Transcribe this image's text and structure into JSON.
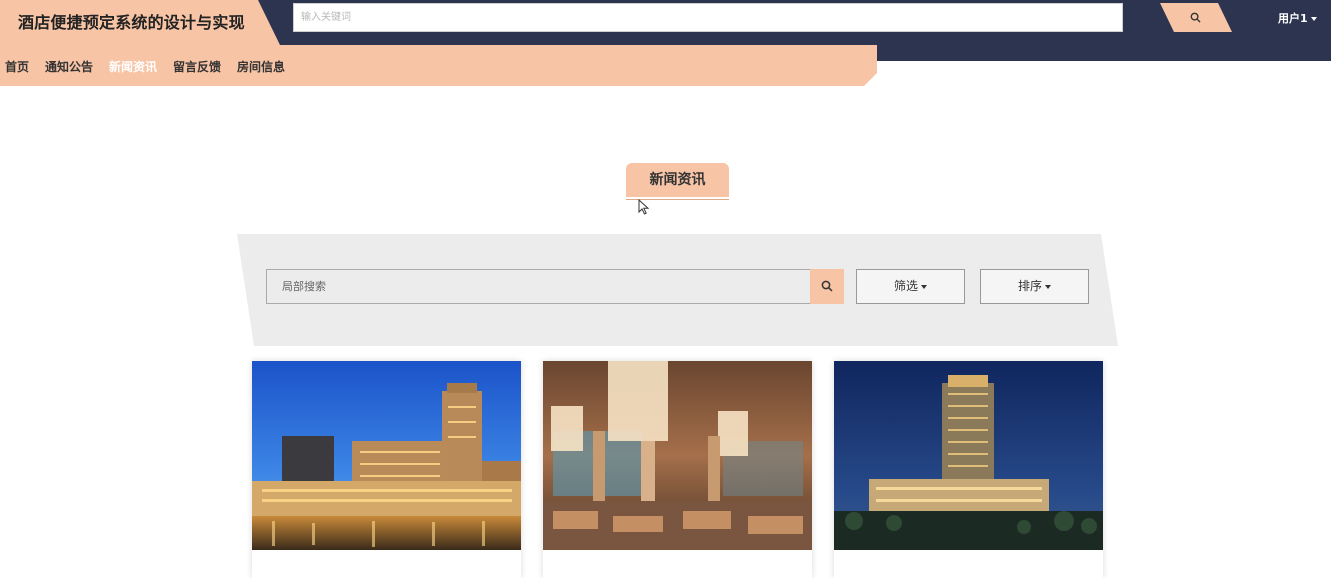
{
  "header": {
    "title": "酒店便捷预定系统的设计与实现",
    "search_placeholder": "输入关键词",
    "user_label": "用户1"
  },
  "nav": {
    "items": [
      "首页",
      "通知公告",
      "新闻资讯",
      "留言反馈",
      "房间信息"
    ],
    "active": "新闻资讯"
  },
  "section": {
    "title": "新闻资讯"
  },
  "filter": {
    "search_placeholder": "局部搜索",
    "filter_label": "筛选",
    "sort_label": "排序"
  },
  "cards": [
    {
      "image": "hotel-night-canal-photo"
    },
    {
      "image": "hotel-lobby-chandelier-photo"
    },
    {
      "image": "hotel-tower-night-photo"
    }
  ],
  "colors": {
    "accent": "#f7c4a6",
    "topbar": "#2d3450",
    "panel": "#ececec"
  }
}
